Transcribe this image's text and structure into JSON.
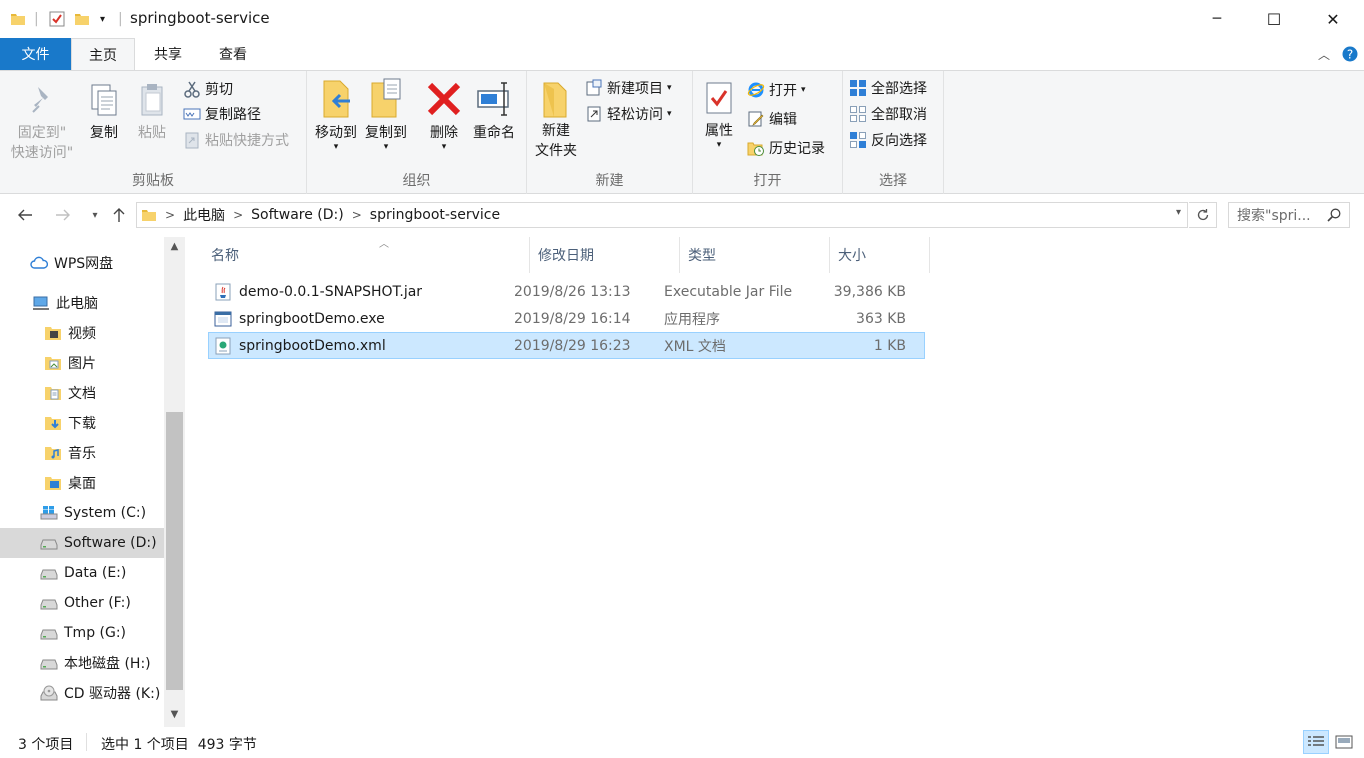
{
  "window": {
    "title": "springboot-service",
    "controls": {
      "minimize": "─",
      "maximize": "☐",
      "close": "✕"
    }
  },
  "tabs": [
    {
      "label": "文件"
    },
    {
      "label": "主页"
    },
    {
      "label": "共享"
    },
    {
      "label": "查看"
    }
  ],
  "ribbon": {
    "clipboard": {
      "label": "剪贴板",
      "pin_line1": "固定到\"",
      "pin_line2": "快速访问\"",
      "copy": "复制",
      "paste": "粘贴",
      "cut": "剪切",
      "copy_path": "复制路径",
      "paste_shortcut": "粘贴快捷方式"
    },
    "organize": {
      "label": "组织",
      "move_to": "移动到",
      "copy_to": "复制到",
      "delete": "删除",
      "rename": "重命名"
    },
    "new": {
      "label": "新建",
      "new_folder_line1": "新建",
      "new_folder_line2": "文件夹",
      "new_item": "新建项目",
      "easy_access": "轻松访问"
    },
    "open": {
      "label": "打开",
      "properties": "属性",
      "open": "打开",
      "edit": "编辑",
      "history": "历史记录"
    },
    "select": {
      "label": "选择",
      "select_all": "全部选择",
      "select_none": "全部取消",
      "invert": "反向选择"
    }
  },
  "address": {
    "crumbs": [
      "此电脑",
      "Software (D:)",
      "springboot-service"
    ],
    "search_placeholder": "搜索\"spri..."
  },
  "sidebar": {
    "items": [
      {
        "label": "WPS网盘"
      },
      {
        "label": "此电脑"
      },
      {
        "label": "视频"
      },
      {
        "label": "图片"
      },
      {
        "label": "文档"
      },
      {
        "label": "下载"
      },
      {
        "label": "音乐"
      },
      {
        "label": "桌面"
      },
      {
        "label": "System (C:)"
      },
      {
        "label": "Software (D:)"
      },
      {
        "label": "Data (E:)"
      },
      {
        "label": "Other (F:)"
      },
      {
        "label": "Tmp (G:)"
      },
      {
        "label": "本地磁盘 (H:)"
      },
      {
        "label": "CD 驱动器 (K:)"
      }
    ]
  },
  "columns": {
    "name": "名称",
    "modified": "修改日期",
    "type": "类型",
    "size": "大小"
  },
  "files": [
    {
      "name": "demo-0.0.1-SNAPSHOT.jar",
      "modified": "2019/8/26 13:13",
      "type": "Executable Jar File",
      "size": "39,386 KB"
    },
    {
      "name": "springbootDemo.exe",
      "modified": "2019/8/29 16:14",
      "type": "应用程序",
      "size": "363 KB"
    },
    {
      "name": "springbootDemo.xml",
      "modified": "2019/8/29 16:23",
      "type": "XML 文档",
      "size": "1 KB"
    }
  ],
  "status": {
    "count": "3 个项目",
    "selection": "选中 1 个项目  493 字节"
  },
  "colors": {
    "accent": "#1979ca",
    "selection": "#cce8ff",
    "selection_border": "#99d1ff"
  }
}
